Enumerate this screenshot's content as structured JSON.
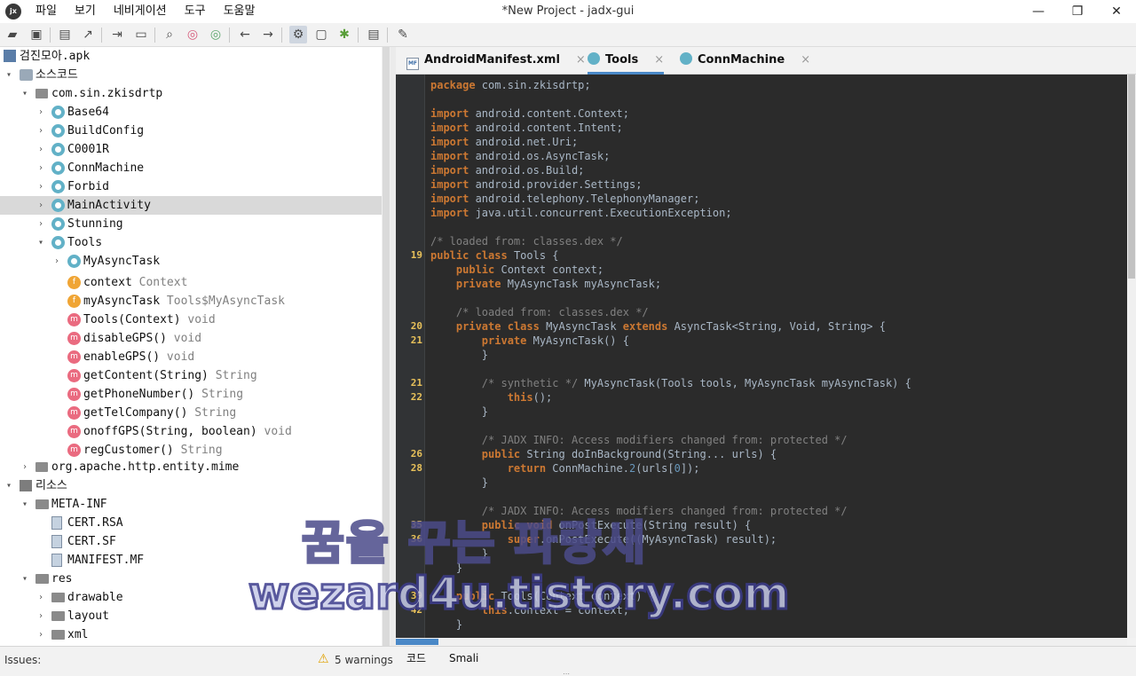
{
  "window": {
    "title": "*New Project - jadx-gui",
    "logo_text": "jx",
    "minimize": "—",
    "maximize": "❐",
    "close": "✕"
  },
  "menu": [
    "파일",
    "보기",
    "네비게이션",
    "도구",
    "도움말"
  ],
  "toolbar_icons": [
    "open-file-icon",
    "add-files-icon",
    "save-icon",
    "export-icon",
    "sync-icon",
    "folder-icon",
    "search-icon",
    "find-usage-icon",
    "find-icon",
    "back-arrow-icon",
    "forward-arrow-icon",
    "deobfuscation-icon",
    "decompile-icon",
    "debug-icon",
    "log-icon",
    "settings-wrench-icon"
  ],
  "tree": [
    {
      "label": "검진모아.apk",
      "icon": "apk",
      "level": 0,
      "arrow": ""
    },
    {
      "label": "소스코드",
      "icon": "src",
      "level": 0,
      "arrow": "▾"
    },
    {
      "label": "com.sin.zkisdrtp",
      "icon": "pkg",
      "level": 1,
      "arrow": "▾"
    },
    {
      "label": "Base64",
      "icon": "cls",
      "level": 2,
      "arrow": "›"
    },
    {
      "label": "BuildConfig",
      "icon": "cls",
      "level": 2,
      "arrow": "›"
    },
    {
      "label": "C0001R",
      "icon": "cls",
      "level": 2,
      "arrow": "›"
    },
    {
      "label": "ConnMachine",
      "icon": "cls",
      "level": 2,
      "arrow": "›"
    },
    {
      "label": "Forbid",
      "icon": "cls",
      "level": 2,
      "arrow": "›"
    },
    {
      "label": "MainActivity",
      "icon": "cls",
      "level": 2,
      "arrow": "›",
      "selected": true
    },
    {
      "label": "Stunning",
      "icon": "cls",
      "level": 2,
      "arrow": "›"
    },
    {
      "label": "Tools",
      "icon": "cls",
      "level": 2,
      "arrow": "▾"
    },
    {
      "label": "MyAsyncTask",
      "icon": "cls",
      "level": 3,
      "arrow": "›"
    },
    {
      "label": "context",
      "type": "Context",
      "icon": "f",
      "level": 3,
      "arrow": ""
    },
    {
      "label": "myAsyncTask",
      "type": "Tools$MyAsyncTask",
      "icon": "f",
      "level": 3,
      "arrow": ""
    },
    {
      "label": "Tools(Context)",
      "type": "void",
      "icon": "m",
      "level": 3,
      "arrow": ""
    },
    {
      "label": "disableGPS()",
      "type": "void",
      "icon": "m",
      "level": 3,
      "arrow": ""
    },
    {
      "label": "enableGPS()",
      "type": "void",
      "icon": "m",
      "level": 3,
      "arrow": ""
    },
    {
      "label": "getContent(String)",
      "type": "String",
      "icon": "m",
      "level": 3,
      "arrow": ""
    },
    {
      "label": "getPhoneNumber()",
      "type": "String",
      "icon": "m",
      "level": 3,
      "arrow": ""
    },
    {
      "label": "getTelCompany()",
      "type": "String",
      "icon": "m",
      "level": 3,
      "arrow": ""
    },
    {
      "label": "onoffGPS(String, boolean)",
      "type": "void",
      "icon": "m",
      "level": 3,
      "arrow": ""
    },
    {
      "label": "regCustomer()",
      "type": "String",
      "icon": "m",
      "level": 3,
      "arrow": ""
    },
    {
      "label": "org.apache.http.entity.mime",
      "icon": "pkg",
      "level": 1,
      "arrow": "›"
    },
    {
      "label": "리소스",
      "icon": "res",
      "level": 0,
      "arrow": "▾"
    },
    {
      "label": "META-INF",
      "icon": "folder",
      "level": 1,
      "arrow": "▾"
    },
    {
      "label": "CERT.RSA",
      "icon": "file",
      "level": 2,
      "arrow": ""
    },
    {
      "label": "CERT.SF",
      "icon": "file",
      "level": 2,
      "arrow": ""
    },
    {
      "label": "MANIFEST.MF",
      "icon": "file",
      "level": 2,
      "arrow": ""
    },
    {
      "label": "res",
      "icon": "folder",
      "level": 1,
      "arrow": "▾"
    },
    {
      "label": "drawable",
      "icon": "folder",
      "level": 2,
      "arrow": "›"
    },
    {
      "label": "layout",
      "icon": "folder",
      "level": 2,
      "arrow": "›"
    },
    {
      "label": "xml",
      "icon": "folder",
      "level": 2,
      "arrow": "›"
    }
  ],
  "tabs": [
    {
      "label": "AndroidManifest.xml",
      "icon": "mf",
      "active": false,
      "close": "×"
    },
    {
      "label": "Tools",
      "icon": "cls",
      "active": true,
      "close": "×"
    },
    {
      "label": "ConnMachine",
      "icon": "cls",
      "active": false,
      "close": "×"
    }
  ],
  "code": [
    {
      "ln": "",
      "text": "package com.sin.zkisdrtp;"
    },
    {
      "ln": "",
      "text": ""
    },
    {
      "ln": "",
      "text": "import android.content.Context;"
    },
    {
      "ln": "",
      "text": "import android.content.Intent;"
    },
    {
      "ln": "",
      "text": "import android.net.Uri;"
    },
    {
      "ln": "",
      "text": "import android.os.AsyncTask;"
    },
    {
      "ln": "",
      "text": "import android.os.Build;"
    },
    {
      "ln": "",
      "text": "import android.provider.Settings;"
    },
    {
      "ln": "",
      "text": "import android.telephony.TelephonyManager;"
    },
    {
      "ln": "",
      "text": "import java.util.concurrent.ExecutionException;"
    },
    {
      "ln": "",
      "text": ""
    },
    {
      "ln": "",
      "text": "/* loaded from: classes.dex */"
    },
    {
      "ln": "19",
      "text": "public class Tools {"
    },
    {
      "ln": "",
      "text": "    public Context context;"
    },
    {
      "ln": "",
      "text": "    private MyAsyncTask myAsyncTask;"
    },
    {
      "ln": "",
      "text": ""
    },
    {
      "ln": "",
      "text": "    /* loaded from: classes.dex */"
    },
    {
      "ln": "20",
      "text": "    private class MyAsyncTask extends AsyncTask<String, Void, String> {"
    },
    {
      "ln": "21",
      "text": "        private MyAsyncTask() {"
    },
    {
      "ln": "",
      "text": "        }"
    },
    {
      "ln": "",
      "text": ""
    },
    {
      "ln": "21",
      "text": "        /* synthetic */ MyAsyncTask(Tools tools, MyAsyncTask myAsyncTask) {"
    },
    {
      "ln": "22",
      "text": "            this();"
    },
    {
      "ln": "",
      "text": "        }"
    },
    {
      "ln": "",
      "text": ""
    },
    {
      "ln": "",
      "text": "        /* JADX INFO: Access modifiers changed from: protected */"
    },
    {
      "ln": "26",
      "text": "        public String doInBackground(String... urls) {"
    },
    {
      "ln": "28",
      "text": "            return ConnMachine.requestData2(urls[0]);"
    },
    {
      "ln": "",
      "text": "        }"
    },
    {
      "ln": "",
      "text": ""
    },
    {
      "ln": "",
      "text": "        /* JADX INFO: Access modifiers changed from: protected */"
    },
    {
      "ln": "35",
      "text": "        public void onPostExecute(String result) {"
    },
    {
      "ln": "36",
      "text": "            super.onPostExecute((MyAsyncTask) result);"
    },
    {
      "ln": "",
      "text": "        }"
    },
    {
      "ln": "",
      "text": "    }"
    },
    {
      "ln": "",
      "text": ""
    },
    {
      "ln": "39",
      "text": "    public Tools(Context context) {"
    },
    {
      "ln": "42",
      "text": "        this.context = context;"
    },
    {
      "ln": "",
      "text": "    }"
    }
  ],
  "status": {
    "issues_label": "Issues:",
    "warnings": "5 warnings",
    "bottom_tabs": [
      "코드",
      "Smali"
    ],
    "grip": "⋯"
  },
  "watermark": {
    "line1": "꿈을 꾸는 파랑새",
    "line2": "wezard4u.tistory.com"
  },
  "colors": {
    "accent": "#4a88c7",
    "editor_bg": "#2b2b2b",
    "keyword": "#cc7832",
    "comment": "#808080",
    "line_number": "#e8c15a",
    "class_icon": "#62b1c7",
    "method_icon": "#ea6b80",
    "field_icon": "#f0a535"
  }
}
